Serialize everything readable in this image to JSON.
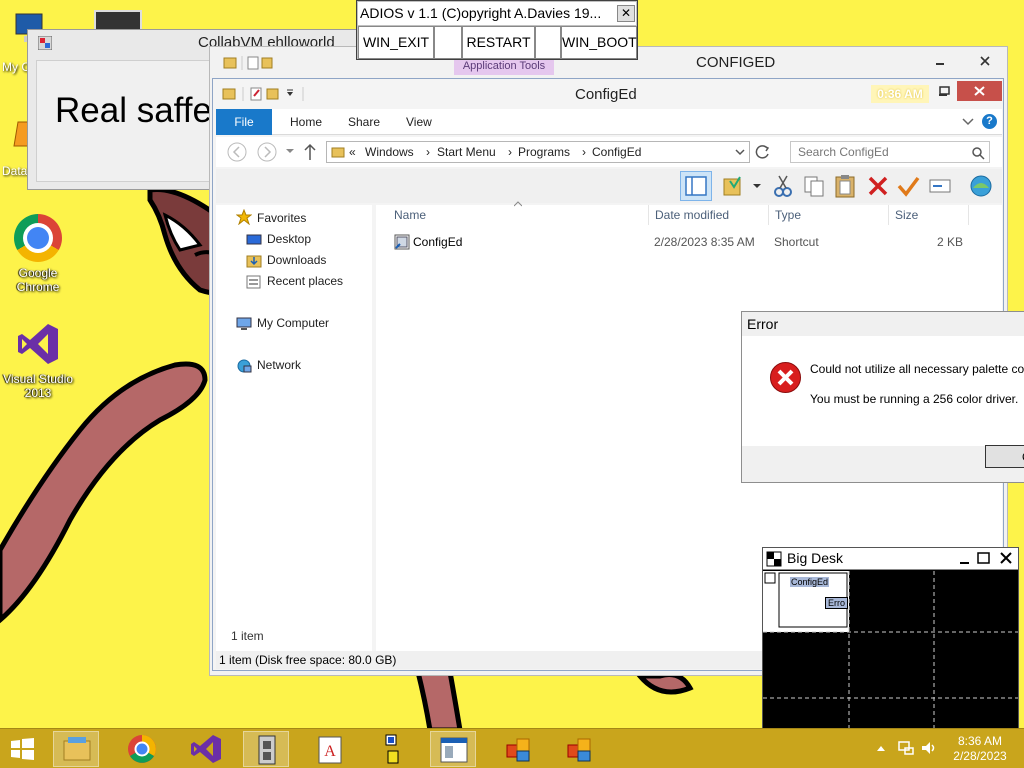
{
  "desktop": {
    "icons": [
      {
        "label_lines": [
          "Google",
          "Chrome"
        ]
      },
      {
        "label_lines": [
          "Visual Studio",
          "2013"
        ]
      }
    ],
    "partial_labels": {
      "my_computer": "My C",
      "data": "Data"
    },
    "background_color": "#fdf34a"
  },
  "collab_window": {
    "title": "CollabVM ehlloworld",
    "content_text": "Real saffe"
  },
  "outer_window": {
    "title": "CONFIGED",
    "contextual_tab": "Application Tools"
  },
  "explorer": {
    "title": "ConfigEd",
    "overlay_time": "0:36 AM",
    "ribbon_tabs": [
      "File",
      "Home",
      "Share",
      "View"
    ],
    "breadcrumb": {
      "overflow": "«",
      "parts": [
        "Windows",
        "Start Menu",
        "Programs",
        "ConfigEd"
      ]
    },
    "search_placeholder": "Search ConfigEd",
    "nav": {
      "favorites": "Favorites",
      "favorites_items": [
        "Desktop",
        "Downloads",
        "Recent places"
      ],
      "my_computer": "My Computer",
      "network": "Network"
    },
    "columns": [
      "Name",
      "Date modified",
      "Type",
      "Size"
    ],
    "files": [
      {
        "name": "ConfigEd",
        "date": "2/28/2023 8:35 AM",
        "type": "Shortcut",
        "size": "2 KB"
      }
    ],
    "item_count": "1 item",
    "status": "1 item (Disk free space: 80.0 GB)",
    "accent": "#1979ca"
  },
  "adios": {
    "title": "ADIOS  v 1.1 (C)opyright A.Davies 19...",
    "close_glyph": "✕",
    "buttons": [
      "WIN_EXIT",
      "RESTART",
      "WIN_BOOT"
    ]
  },
  "error_dialog": {
    "title": "Error",
    "line1": "Could not utilize all necessary palette colors",
    "line2": "You must be running a 256 color driver.",
    "ok_label": "OK",
    "icon_color": "#d81e1e"
  },
  "bigdesk": {
    "title": "Big Desk",
    "thumb_labels": [
      "ConfigEd",
      "Erro"
    ]
  },
  "taskbar": {
    "time": "8:36 AM",
    "date": "2/28/2023",
    "color": "#c9a51c"
  }
}
